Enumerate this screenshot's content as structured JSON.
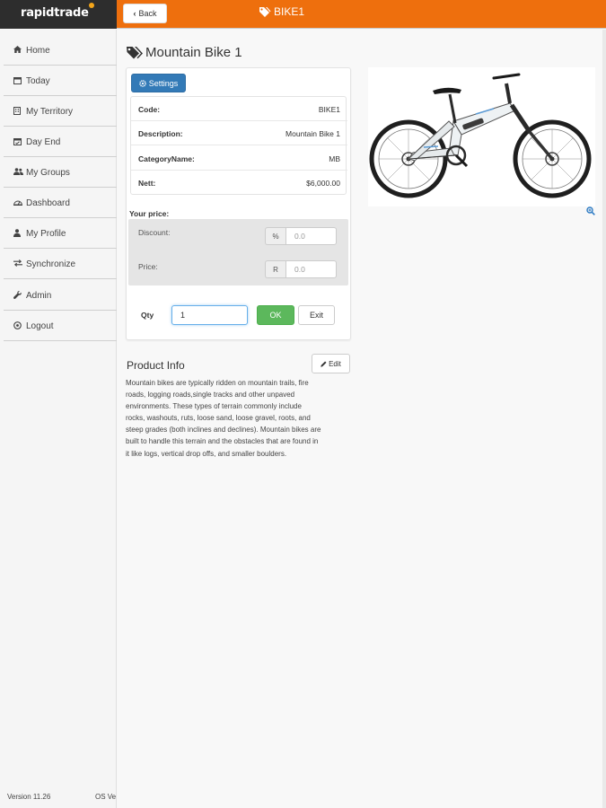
{
  "app": {
    "logo_text": "rapidtrade",
    "brand_color": "#ee6f0d"
  },
  "header": {
    "back_label": "Back",
    "title": "BIKE1"
  },
  "sidebar": {
    "items": [
      {
        "label": "Home",
        "icon": "home-icon"
      },
      {
        "label": "Today",
        "icon": "calendar-icon"
      },
      {
        "label": "My Territory",
        "icon": "building-icon"
      },
      {
        "label": "Day End",
        "icon": "calendar-check-icon"
      },
      {
        "label": "My Groups",
        "icon": "users-icon"
      },
      {
        "label": "Dashboard",
        "icon": "dashboard-icon"
      },
      {
        "label": "My Profile",
        "icon": "user-icon"
      },
      {
        "label": "Synchronize",
        "icon": "exchange-icon"
      },
      {
        "label": "Admin",
        "icon": "wrench-icon"
      },
      {
        "label": "Logout",
        "icon": "power-icon"
      }
    ],
    "version": "Version 11.26",
    "os_version": "OS Ve"
  },
  "product": {
    "title": "Mountain Bike 1",
    "settings_label": "Settings",
    "details": [
      {
        "label": "Code:",
        "value": "BIKE1"
      },
      {
        "label": "Description:",
        "value": "Mountain Bike 1"
      },
      {
        "label": "CategoryName:",
        "value": "MB"
      },
      {
        "label": "Nett:",
        "value": "$6,000.00"
      }
    ],
    "your_price_label": "Your price:",
    "discount_label": "Discount:",
    "discount_addon": "%",
    "discount_placeholder": "0.0",
    "price_label": "Price:",
    "price_addon": "R",
    "price_placeholder": "0.0",
    "qty_label": "Qty",
    "qty_value": "1",
    "ok_label": "OK",
    "exit_label": "Exit"
  },
  "product_info": {
    "title": "Product Info",
    "edit_label": "Edit",
    "lines": [
      "Mountain bikes are typically ridden on mountain trails, fire",
      "roads, logging roads,single tracks and other unpaved",
      "environments. These types of terrain commonly include",
      "rocks, washouts, ruts, loose sand, loose gravel, roots, and",
      "steep grades (both inclines and declines). Mountain bikes are",
      "built to handle this terrain and the obstacles that are found in",
      "it like logs, vertical drop offs, and smaller boulders."
    ]
  }
}
